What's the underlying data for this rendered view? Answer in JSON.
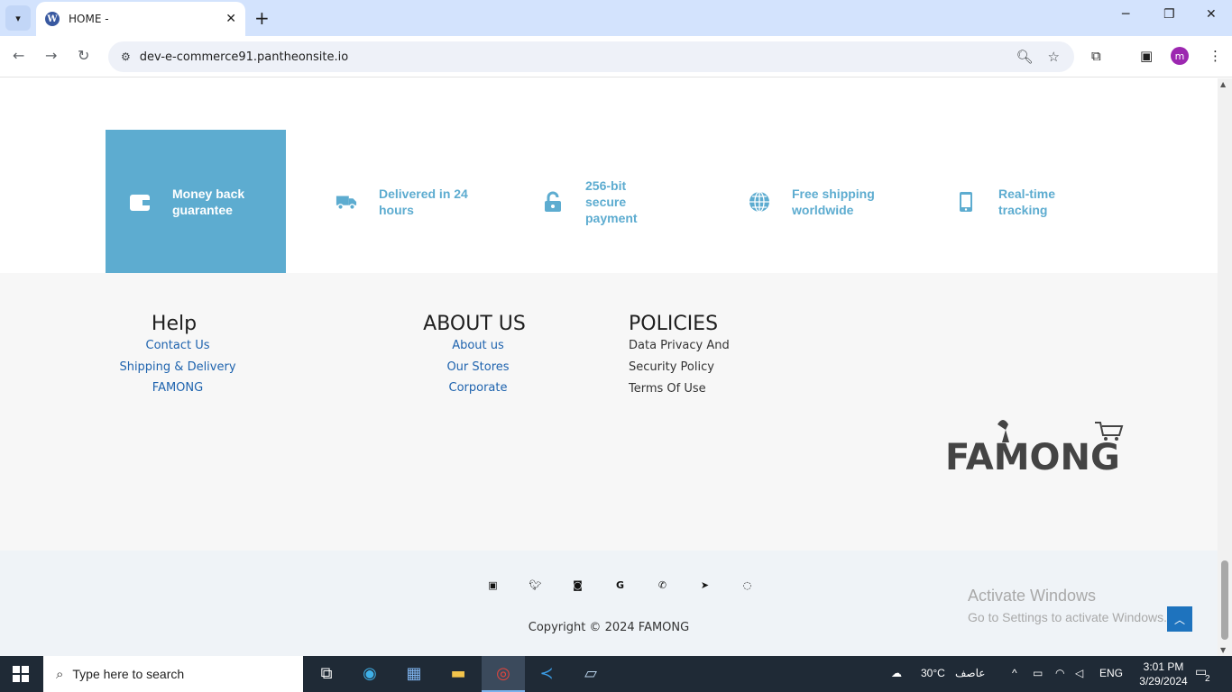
{
  "browser": {
    "tab_title": "HOME -",
    "url": "dev-e-commerce91.pantheonsite.io",
    "profile_initial": "m"
  },
  "features": [
    {
      "label": "Money back guarantee",
      "icon": "wallet-icon"
    },
    {
      "label": "Delivered in 24 hours",
      "icon": "truck-icon"
    },
    {
      "label": "256-bit secure payment",
      "icon": "unlock-icon"
    },
    {
      "label": "Free shipping worldwide",
      "icon": "globe-icon"
    },
    {
      "label": "Real-time tracking",
      "icon": "mobile-icon"
    }
  ],
  "footer": {
    "help": {
      "title": "Help",
      "links": [
        "Contact Us",
        "Shipping & Delivery",
        "FAMONG"
      ]
    },
    "about": {
      "title": "ABOUT US",
      "links": [
        "About us",
        "Our Stores",
        "Corporate"
      ]
    },
    "policies": {
      "title": "POLICIES",
      "links": [
        "Data Privacy And",
        "Security Policy",
        "Terms Of Use"
      ]
    },
    "logo_text": "FAMONG"
  },
  "social_icons": [
    "facebook-icon",
    "twitter-icon",
    "instagram-icon",
    "google-icon",
    "phone-icon",
    "telegram-icon",
    "whatsapp-icon"
  ],
  "copyright": "Copyright © 2024 FAMONG",
  "watermark": {
    "line1": "Activate Windows",
    "line2": "Go to Settings to activate Windows."
  },
  "taskbar": {
    "search_placeholder": "Type here to search",
    "temperature": "30°C",
    "weather": "عاصف",
    "language": "ENG",
    "time": "3:01 PM",
    "date": "3/29/2024",
    "notification_count": "2"
  },
  "colors": {
    "accent": "#5dacd0",
    "link": "#1e63ae",
    "to_top": "#1e73be"
  }
}
